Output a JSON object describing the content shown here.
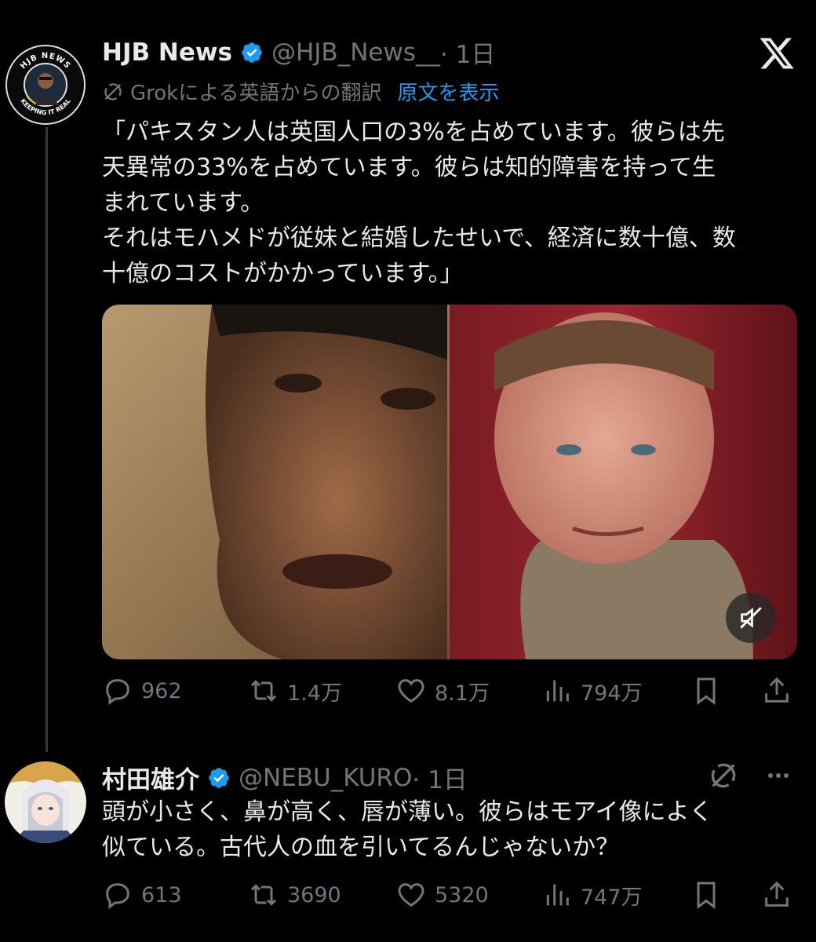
{
  "colors": {
    "background": "#000000",
    "text_primary": "#e7e9ea",
    "text_secondary": "#71767b",
    "link": "#1d9bf0",
    "verified": "#1d9bf0"
  },
  "tweet": {
    "display_name": "HJB News",
    "handle": "@HJB_News__",
    "time": " · 1日",
    "avatar_ring_top": "HJB NEWS",
    "avatar_ring_bottom": "KEEPING IT REAL",
    "translation_label": "Grokによる英語からの翻訳",
    "show_original": "原文を表示",
    "text": "「パキスタン人は英国人口の3%を占めています。彼らは先\n天異常の33%を占めています。彼らは知的障害を持って生\nまれています。\nそれはモハメドが従妹と結婚したせいで、経済に数十億、数\n十億のコストがかかっています。」",
    "stats": {
      "replies": "962",
      "reposts": "1.4万",
      "likes": "8.1万",
      "views": "794万"
    },
    "icons": [
      "x-logo-icon",
      "translate-icon",
      "verified-badge-icon",
      "mute-icon",
      "reply-icon",
      "repost-icon",
      "like-icon",
      "views-icon",
      "bookmark-icon",
      "share-icon"
    ]
  },
  "reply": {
    "display_name": "村田雄介",
    "handle": "@NEBU_KURO",
    "time": " · 1日",
    "text": "頭が小さく、鼻が高く、唇が薄い。彼らはモアイ像によく\n似ている。古代人の血を引いてるんじゃないか？",
    "stats": {
      "replies": "613",
      "reposts": "3690",
      "likes": "5320",
      "views": "747万"
    },
    "icons": [
      "grok-icon",
      "more-icon"
    ]
  }
}
